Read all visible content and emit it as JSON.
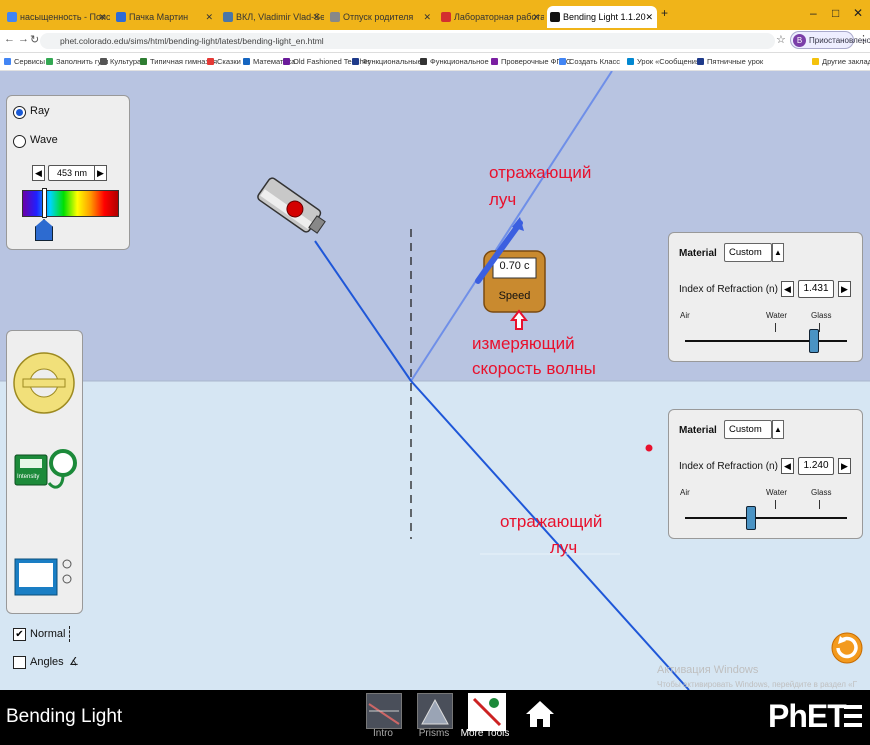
{
  "browser": {
    "tabs": [
      {
        "label": "насыщенность - Поиск в Google",
        "active": false
      },
      {
        "label": "Пачка Мартин",
        "active": false
      },
      {
        "label": "ВКЛ, Vladimir Vlad-Sele - studen",
        "active": false
      },
      {
        "label": "Отпуск родителя",
        "active": false
      },
      {
        "label": "Лабораторная работа «Отражен",
        "active": false
      },
      {
        "label": "Bending Light 1.1.20",
        "active": true
      }
    ],
    "url": "phet.colorado.edu/sims/html/bending-light/latest/bending-light_en.html",
    "profile_label": "Приостановлено",
    "profile_initial": "В",
    "bookmarks": [
      "Сервисы",
      "Заполнить гугл",
      "Культура",
      "Типичная гимназия",
      "Сказки",
      "Математика",
      "Old Fashioned Teacher",
      "Функциональные",
      "Функциональное",
      "Проверочные ФГОС",
      "Создать Класс",
      "Урок «Сообщения»",
      "Пятничные урок"
    ],
    "bookmarks_other": "Другие закладки"
  },
  "sim": {
    "light_mode": {
      "ray_label": "Ray",
      "wave_label": "Wave",
      "selected": "Ray"
    },
    "wavelength": {
      "value": "453 nm"
    },
    "speed_tool": {
      "value": "0.70 c",
      "label": "Speed"
    },
    "top_material": {
      "header": "Material",
      "selection": "Custom",
      "index_label": "Index of Refraction (n)",
      "index_value": "1.431",
      "ticks": [
        "Air",
        "Water",
        "Glass"
      ],
      "slider_fraction": 0.79
    },
    "bottom_material": {
      "header": "Material",
      "selection": "Custom",
      "index_label": "Index of Refraction (n)",
      "index_value": "1.240",
      "ticks": [
        "Air",
        "Water",
        "Glass"
      ],
      "slider_fraction": 0.4
    },
    "toolbox": {
      "intensity_label": "Intensity",
      "normal_label": "Normal",
      "normal_checked": true,
      "angles_label": "Angles",
      "angles_checked": false
    },
    "annotations": {
      "reflected_top": [
        "отражающий",
        "луч"
      ],
      "speed_note": [
        "измеряющий",
        "скорость волны"
      ],
      "refracted_bottom": [
        "отражающий",
        "луч"
      ]
    },
    "colors": {
      "upper_medium": "#b8c4e1",
      "lower_medium": "#d6e6f3",
      "ray": "#1f57d8",
      "annotation": "#e8112d"
    }
  },
  "navbar": {
    "title": "Bending Light",
    "screens": [
      "Intro",
      "Prisms",
      "More Tools"
    ],
    "active_screen": "More Tools",
    "brand": "PhET"
  },
  "watermark": {
    "line1": "Активация Windows",
    "line2": "Чтобы активировать Windows, перейдите в раздел «Параметры»",
    "line3": "компьютера"
  }
}
